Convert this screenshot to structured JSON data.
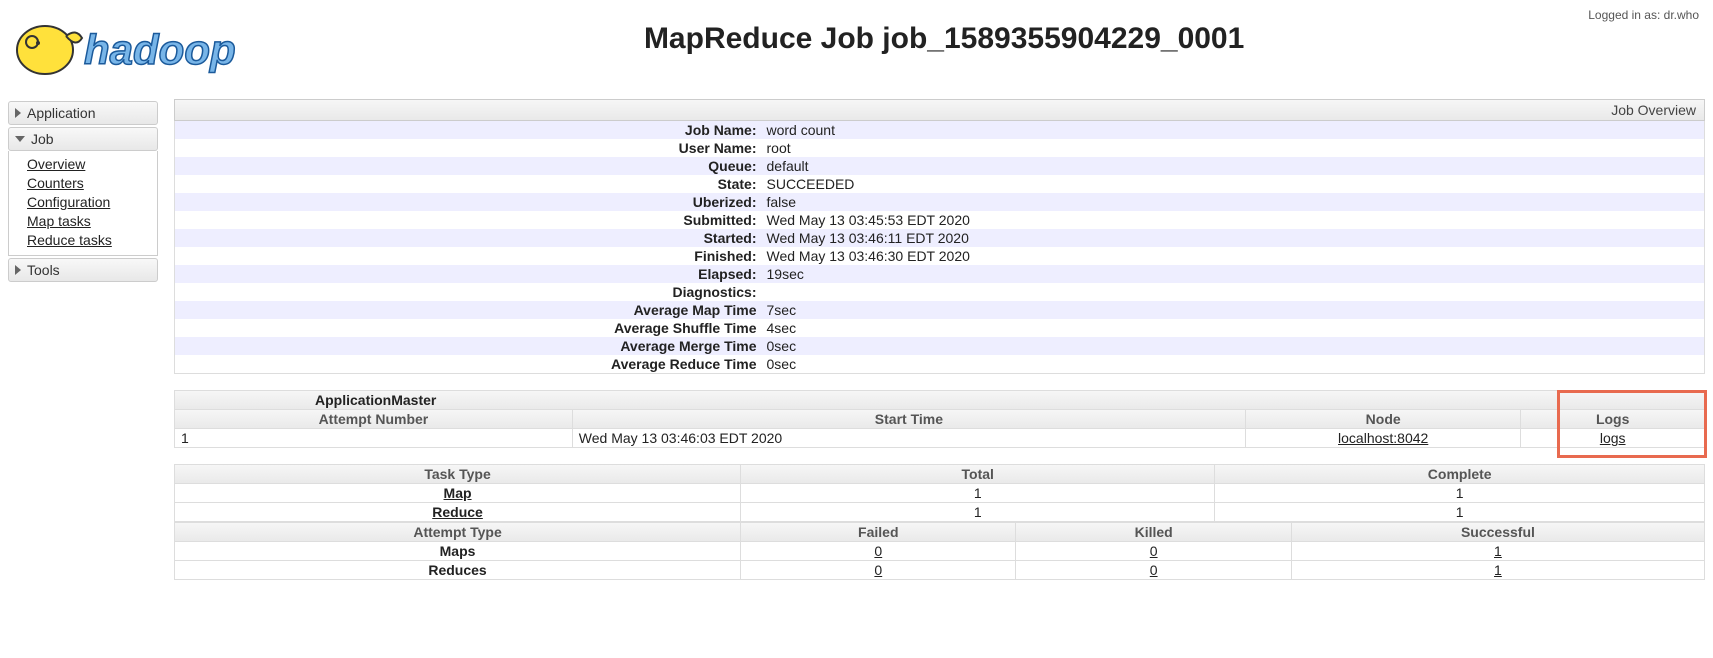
{
  "login_text": "Logged in as: dr.who",
  "page_title": "MapReduce Job job_1589355904229_0001",
  "sidebar": {
    "application": "Application",
    "job_head": "Job",
    "job_items": [
      "Overview",
      "Counters",
      "Configuration",
      "Map tasks",
      "Reduce tasks"
    ],
    "tools": "Tools"
  },
  "overview_header": "Job Overview",
  "kv": [
    {
      "k": "Job Name:",
      "v": "word count"
    },
    {
      "k": "User Name:",
      "v": "root"
    },
    {
      "k": "Queue:",
      "v": "default"
    },
    {
      "k": "State:",
      "v": "SUCCEEDED"
    },
    {
      "k": "Uberized:",
      "v": "false"
    },
    {
      "k": "Submitted:",
      "v": "Wed May 13 03:45:53 EDT 2020"
    },
    {
      "k": "Started:",
      "v": "Wed May 13 03:46:11 EDT 2020"
    },
    {
      "k": "Finished:",
      "v": "Wed May 13 03:46:30 EDT 2020"
    },
    {
      "k": "Elapsed:",
      "v": "19sec"
    },
    {
      "k": "Diagnostics:",
      "v": ""
    },
    {
      "k": "Average Map Time",
      "v": "7sec"
    },
    {
      "k": "Average Shuffle Time",
      "v": "4sec"
    },
    {
      "k": "Average Merge Time",
      "v": "0sec"
    },
    {
      "k": "Average Reduce Time",
      "v": "0sec"
    }
  ],
  "am_table": {
    "caption": "ApplicationMaster",
    "headers": [
      "Attempt Number",
      "Start Time",
      "Node",
      "Logs"
    ],
    "row": {
      "attempt": "1",
      "start": "Wed May 13 03:46:03 EDT 2020",
      "node": "localhost:8042",
      "logs": "logs"
    }
  },
  "task_table": {
    "headers": [
      "Task Type",
      "Total",
      "Complete"
    ],
    "rows": [
      {
        "type": "Map",
        "total": "1",
        "complete": "1"
      },
      {
        "type": "Reduce",
        "total": "1",
        "complete": "1"
      }
    ]
  },
  "attempt_table": {
    "headers": [
      "Attempt Type",
      "Failed",
      "Killed",
      "Successful"
    ],
    "rows": [
      {
        "type": "Maps",
        "failed": "0",
        "killed": "0",
        "successful": "1"
      },
      {
        "type": "Reduces",
        "failed": "0",
        "killed": "0",
        "successful": "1"
      }
    ]
  }
}
